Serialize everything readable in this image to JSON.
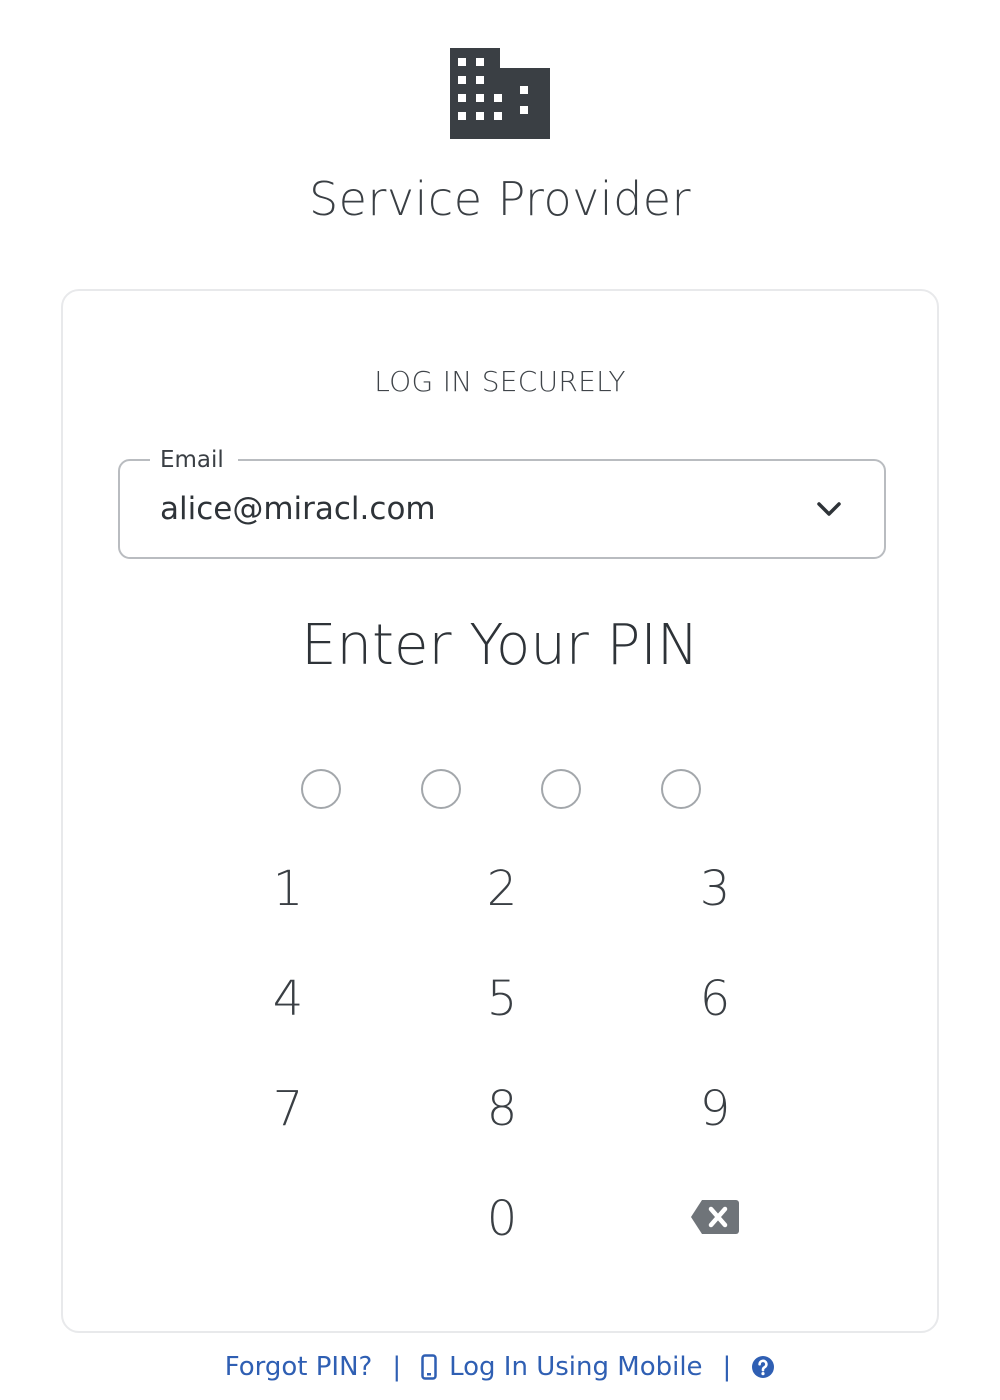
{
  "app": {
    "title": "Service Provider",
    "logo_icon": "building-icon"
  },
  "card": {
    "heading": "LOG IN SECURELY",
    "email": {
      "label": "Email",
      "value": "alice@miracl.com",
      "dropdown_icon": "chevron-down-icon"
    },
    "pin_heading": "Enter Your PIN",
    "pin_length": 4,
    "pin_entered": 0,
    "keypad": {
      "keys": [
        "1",
        "2",
        "3",
        "4",
        "5",
        "6",
        "7",
        "8",
        "9",
        "0"
      ],
      "backspace_icon": "backspace-icon"
    }
  },
  "footer": {
    "forgot_pin": "Forgot PIN?",
    "separator": "|",
    "mobile_login": "Log In Using Mobile",
    "mobile_icon": "mobile-phone-icon",
    "help_icon": "help-icon"
  },
  "colors": {
    "text": "#3a3f44",
    "link": "#2f5fb3",
    "border": "#b9bcc0",
    "logo": "#3a3f44"
  }
}
